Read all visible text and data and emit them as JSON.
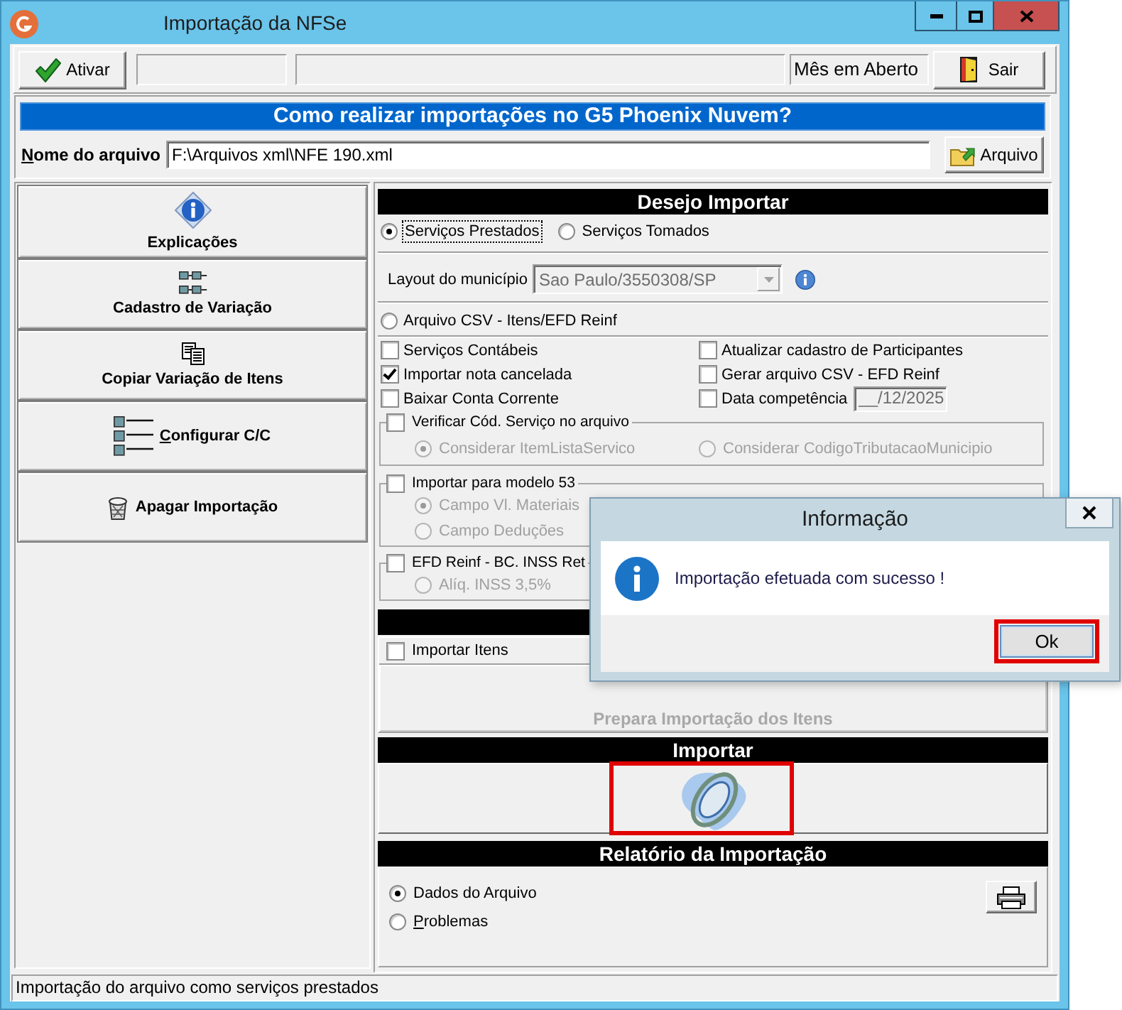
{
  "window": {
    "title": "Importação da NFSe"
  },
  "toolbar": {
    "activate_button": {
      "label": "Ativar"
    },
    "period_status": "Mês em Aberto",
    "exit_button": {
      "label": "Sair"
    }
  },
  "file_frame": {
    "help_banner": "Como realizar importações no G5 Phoenix Nuvem?",
    "file_label": "Nome do arquivo",
    "file_label_underlined": true,
    "file_path": "F:\\Arquivos xml\\NFE 190.xml",
    "browse_button": {
      "label": "Arquivo"
    }
  },
  "sidebar": {
    "buttons": [
      {
        "label": "Explicações",
        "kind": "stacked",
        "access_key_underlined": false
      },
      {
        "label": "Cadastro de Variação",
        "kind": "stacked",
        "access_key_underlined": false
      },
      {
        "label": "Copiar Variação de Itens",
        "kind": "stacked",
        "access_key_underlined": false
      },
      {
        "label": "Configurar C/C",
        "kind": "inline",
        "access_key_underlined": true
      },
      {
        "label": "Apagar Importação",
        "kind": "inline",
        "access_key_underlined": false
      }
    ]
  },
  "import_section": {
    "title": "Desejo Importar",
    "service_types": [
      {
        "label": "Serviços Prestados",
        "selected": true,
        "focused": true
      },
      {
        "label": "Serviços Tomados",
        "selected": false,
        "focused": false
      }
    ],
    "layout": {
      "label": "Layout do município",
      "value": "Sao Paulo/3550308/SP",
      "disabled": true
    },
    "csv_option": {
      "label": "Arquivo CSV - Itens/EFD Reinf",
      "selected": false
    },
    "options_left": [
      {
        "label": "Serviços Contábeis",
        "checked": false
      },
      {
        "label": "Importar nota cancelada",
        "checked": true
      },
      {
        "label": "Baixar Conta Corrente",
        "checked": false
      }
    ],
    "options_right": [
      {
        "label": "Atualizar cadastro de Participantes",
        "checked": false
      },
      {
        "label": "Gerar arquivo CSV - EFD Reinf",
        "checked": false
      },
      {
        "label": "Data competência",
        "checked": false,
        "date_field": {
          "value": "__/12/2025",
          "disabled": true
        }
      }
    ],
    "groups": [
      {
        "label": "Verificar Cód. Serviço no arquivo",
        "checked": false,
        "kind": "row",
        "choices": [
          {
            "label": "Considerar ItemListaServico",
            "selected": true,
            "disabled": true
          },
          {
            "label": "Considerar CodigoTributacaoMunicipio",
            "selected": false,
            "disabled": true
          }
        ]
      },
      {
        "label": "Importar para modelo 53",
        "checked": false,
        "kind": "column",
        "choices": [
          {
            "label": "Campo Vl. Materiais",
            "selected": true,
            "disabled": true
          },
          {
            "label": "Campo Deduções",
            "selected": false,
            "disabled": true
          }
        ]
      },
      {
        "label": "EFD Reinf - BC. INSS Ret",
        "checked": false,
        "kind": "column",
        "choices": [
          {
            "label": "Alíq. INSS 3,5%",
            "selected": false,
            "disabled": true
          }
        ]
      }
    ]
  },
  "items_section": {
    "import_items": {
      "label": "Importar Itens",
      "checked": false
    },
    "prepare_button": {
      "label": "Prepara Importação dos Itens",
      "disabled": true
    }
  },
  "import_action": {
    "title": "Importar",
    "highlighted": true
  },
  "report": {
    "title": "Relatório da Importação",
    "options": [
      {
        "label": "Dados do Arquivo",
        "selected": true,
        "access_key_underlined": false
      },
      {
        "label": "Problemas",
        "selected": false,
        "access_key_underlined": true
      }
    ]
  },
  "status_bar": {
    "text": "Importação do arquivo como serviços prestados"
  },
  "dialog": {
    "title": "Informação",
    "message": "Importação efetuada com sucesso !",
    "ok_button": {
      "label": "Ok",
      "highlighted": true
    }
  }
}
